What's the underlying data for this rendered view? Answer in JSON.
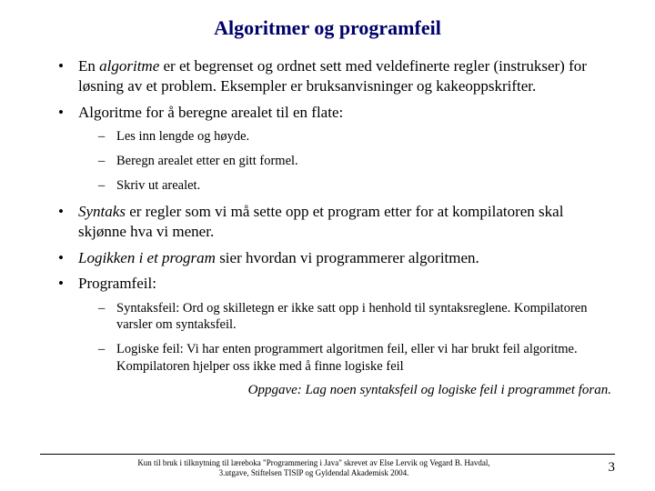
{
  "title": "Algoritmer og programfeil",
  "bullets": {
    "b1_pre": "En ",
    "b1_em": "algoritme",
    "b1_post": " er et begrenset og ordnet sett med veldefinerte regler (instrukser) for løsning av et problem. Eksempler er bruksanvisninger og kakeoppskrifter.",
    "b2": "Algoritme for å beregne arealet til en flate:",
    "b2_sub": [
      "Les inn lengde og høyde.",
      "Beregn arealet etter en gitt formel.",
      "Skriv ut arealet."
    ],
    "b3_em": "Syntaks",
    "b3_post": " er regler som vi må sette opp et program etter for at kompilatoren skal skjønne hva vi mener.",
    "b4_em": "Logikken i et program",
    "b4_post": " sier hvordan vi programmerer algoritmen.",
    "b5": "Programfeil:",
    "b5_sub": [
      "Syntaksfeil: Ord og skilletegn er ikke satt opp i henhold til syntaksreglene. Kompilatoren varsler om syntaksfeil.",
      "Logiske feil: Vi har enten programmert algoritmen feil, eller vi har brukt feil algoritme. Kompilatoren hjelper oss ikke med å finne logiske feil"
    ]
  },
  "assignment": "Oppgave: Lag noen syntaksfeil og logiske feil i programmet foran.",
  "footer": {
    "line1": "Kun til bruk i tilknytning til læreboka \"Programmering i Java\" skrevet av Else Lervik og Vegard B. Havdal,",
    "line2": "3.utgave, Stiftelsen TISIP og Gyldendal Akademisk 2004."
  },
  "page": "3"
}
